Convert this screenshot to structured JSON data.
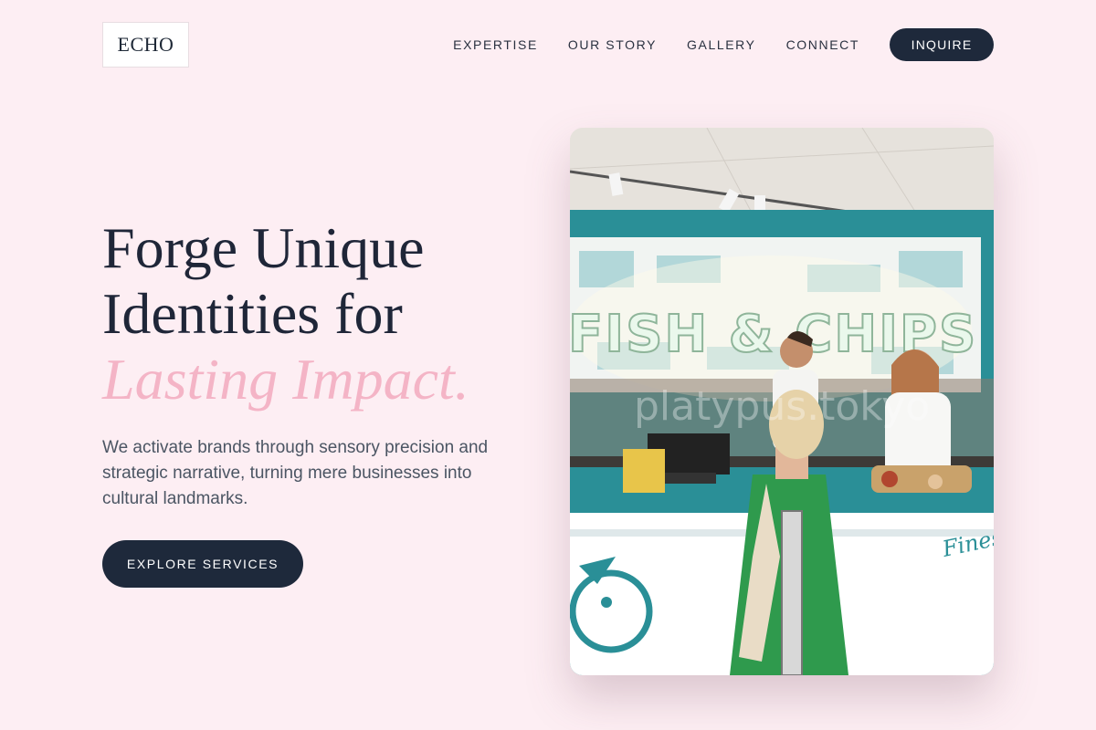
{
  "brand": {
    "logo_text": "ECHO"
  },
  "nav": {
    "items": [
      "EXPERTISE",
      "OUR STORY",
      "GALLERY",
      "CONNECT"
    ],
    "cta": "INQUIRE"
  },
  "hero": {
    "headline_line1": "Forge Unique",
    "headline_line2": "Identities for",
    "headline_accent": "Lasting Impact.",
    "subtext": "We activate brands through sensory precision and strategic narrative, turning mere businesses into cultural landmarks.",
    "button": "EXPLORE SERVICES",
    "image": {
      "sign_text": "FISH & CHIPS",
      "counter_text": "Finest",
      "watermark": "platypus.tokyo"
    }
  },
  "colors": {
    "background": "#fdeef3",
    "dark": "#1e293b",
    "accent_pink": "#f4b4c6",
    "teal": "#2a8f97"
  }
}
